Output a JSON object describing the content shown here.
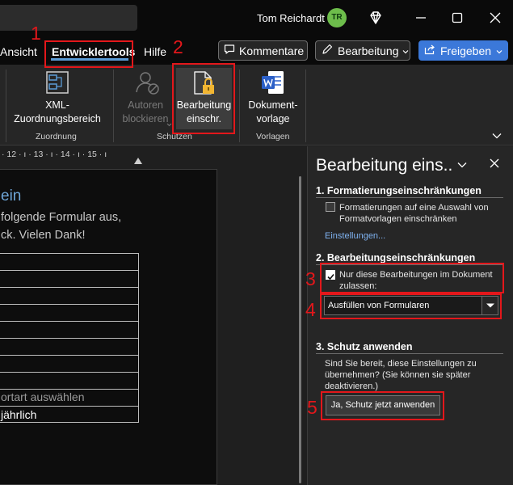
{
  "titlebar": {
    "user_name": "Tom Reichardt",
    "avatar_initials": "TR"
  },
  "tabs": {
    "ansicht": "Ansicht",
    "entwicklertools": "Entwicklertools",
    "hilfe": "Hilfe"
  },
  "top_buttons": {
    "comments": "Kommentare",
    "editing": "Bearbeitung",
    "share": "Freigeben"
  },
  "ribbon": {
    "xml_mapping_line1": "XML-",
    "xml_mapping_line2": "Zuordnungsbereich",
    "block_authors_line1": "Autoren",
    "block_authors_line2": "blockieren",
    "restrict_editing_line1": "Bearbeitung",
    "restrict_editing_line2": "einschr.",
    "doc_template_line1": "Dokument-",
    "doc_template_line2": "vorlage",
    "group_mapping": "Zuordnung",
    "group_protect": "Schützen",
    "group_templates": "Vorlagen"
  },
  "ruler": {
    "ticks": "· 12 · ı · 13 · ı · 14 · ı · 15 · ı"
  },
  "annotations": [
    "1",
    "2",
    "3",
    "4",
    "5"
  ],
  "document": {
    "heading": "ein",
    "line1": "folgende Formular aus,",
    "line2": "ck. Vielen Dank!",
    "table_row_text1": "ortart auswählen",
    "table_row_text2": " jährlich"
  },
  "pane": {
    "title": "Bearbeitung eins..",
    "section1_title": "1. Formatierungseinschränkungen",
    "formatting_option": "Formatierungen auf eine Auswahl von Formatvorlagen einschränken",
    "settings_link": "Einstellungen...",
    "section2_title": "2. Bearbeitungseinschränkungen",
    "editing_option": "Nur diese Bearbeitungen im Dokument zulassen:",
    "editing_option_checked": true,
    "editing_type": "Ausfüllen von Formularen",
    "section3_title": "3. Schutz anwenden",
    "apply_text": "Sind Sie bereit, diese Einstellungen zu übernehmen? (Sie können sie später deaktivieren.)",
    "apply_button": "Ja, Schutz jetzt anwenden"
  },
  "colors": {
    "accent_blue": "#3b78d9",
    "annotation_red": "#e3171b",
    "avatar_green": "#6dbd4b",
    "word_icon_blue": "#2b5fc7"
  }
}
